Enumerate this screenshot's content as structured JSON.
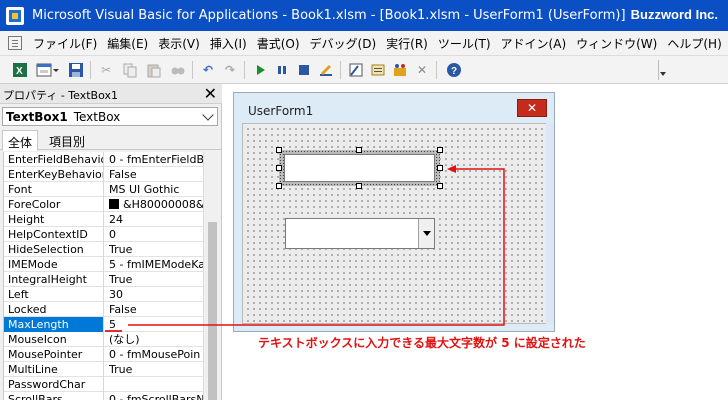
{
  "window": {
    "title": "Microsoft Visual Basic for Applications - Book1.xlsm - [Book1.xlsm - UserForm1 (UserForm)]",
    "brand": "Buzzword Inc."
  },
  "menu": [
    "ファイル(F)",
    "編集(E)",
    "表示(V)",
    "挿入(I)",
    "書式(O)",
    "デバッグ(D)",
    "実行(R)",
    "ツール(T)",
    "アドイン(A)",
    "ウィンドウ(W)",
    "ヘルプ(H)"
  ],
  "toolbar": {
    "icons": [
      "excel-view-icon",
      "insert-userform-icon",
      "save-icon",
      "cut-icon",
      "copy-icon",
      "paste-icon",
      "find-icon",
      "undo-icon",
      "redo-icon",
      "run-icon",
      "break-icon",
      "reset-icon",
      "design-mode-icon",
      "project-explorer-icon",
      "properties-window-icon",
      "object-browser-icon",
      "toolbox-icon",
      "help-icon"
    ]
  },
  "properties": {
    "panel_title": "プロパティ - TextBox1",
    "object_name": "TextBox1",
    "object_type": "TextBox",
    "tabs": [
      "全体",
      "項目別"
    ],
    "rows": [
      {
        "name": "EnterFieldBehavior",
        "value": "0 - fmEnterFieldB"
      },
      {
        "name": "EnterKeyBehavior",
        "value": "False"
      },
      {
        "name": "Font",
        "value": "MS UI Gothic"
      },
      {
        "name": "ForeColor",
        "value": "&H80000008&",
        "swatch": "#000000"
      },
      {
        "name": "Height",
        "value": "24"
      },
      {
        "name": "HelpContextID",
        "value": "0"
      },
      {
        "name": "HideSelection",
        "value": "True"
      },
      {
        "name": "IMEMode",
        "value": "5 - fmIMEModeKa"
      },
      {
        "name": "IntegralHeight",
        "value": "True"
      },
      {
        "name": "Left",
        "value": "30"
      },
      {
        "name": "Locked",
        "value": "False"
      },
      {
        "name": "MaxLength",
        "value": "5",
        "selected": true
      },
      {
        "name": "MouseIcon",
        "value": "(なし)"
      },
      {
        "name": "MousePointer",
        "value": "0 - fmMousePoin"
      },
      {
        "name": "MultiLine",
        "value": "True"
      },
      {
        "name": "PasswordChar",
        "value": ""
      },
      {
        "name": "ScrollBars",
        "value": "0 - fmScrollBarsN"
      }
    ]
  },
  "userform": {
    "title": "UserForm1",
    "close_glyph": "✕"
  },
  "annotation": {
    "text": "テキストボックスに入力できる最大文字数が 5 に設定された",
    "color": "#e01212"
  }
}
